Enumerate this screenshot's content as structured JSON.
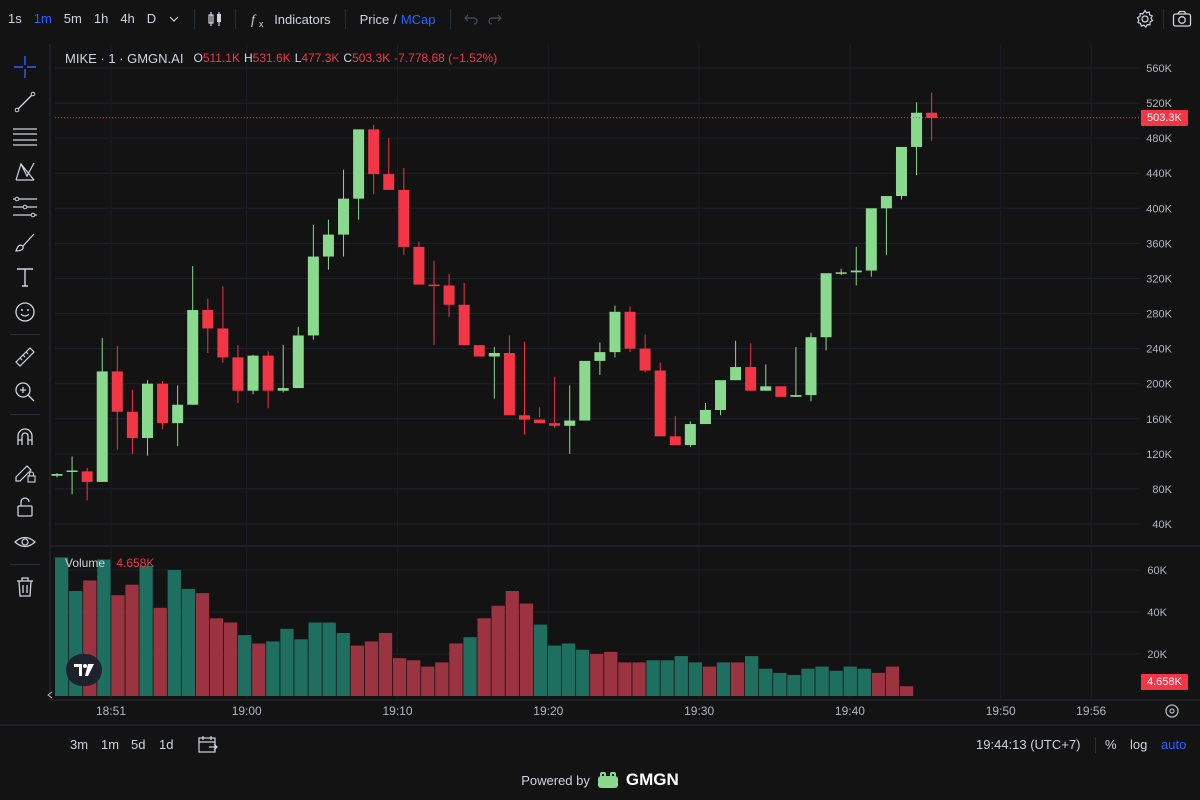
{
  "topbar": {
    "timeframes": [
      {
        "label": "1s",
        "active": false
      },
      {
        "label": "1m",
        "active": true
      },
      {
        "label": "5m",
        "active": false
      },
      {
        "label": "1h",
        "active": false
      },
      {
        "label": "4h",
        "active": false
      },
      {
        "label": "D",
        "active": false
      }
    ],
    "indicators_label": "Indicators",
    "price_label": "Price",
    "slash": "/",
    "mcap_label": "MCap"
  },
  "legend": {
    "symbol": "MIKE · 1 · GMGN.AI",
    "open_key": "O",
    "open": "511.1K",
    "high_key": "H",
    "high": "531.6K",
    "low_key": "L",
    "low": "477.3K",
    "close_key": "C",
    "close": "503.3K",
    "change": "-7.778,68 (−1.52%)"
  },
  "volume_legend": {
    "label": "Volume",
    "value": "4.658K"
  },
  "price_axis_labels": [
    "560K",
    "520K",
    "480K",
    "440K",
    "400K",
    "360K",
    "320K",
    "280K",
    "240K",
    "200K",
    "160K",
    "120K",
    "80K",
    "40K"
  ],
  "volume_axis_labels": [
    "60K",
    "40K",
    "20K"
  ],
  "last_price_tag": "503.3K",
  "last_volume_tag": "4.658K",
  "time_axis_labels": [
    "18:51",
    "19:00",
    "19:10",
    "19:20",
    "19:30",
    "19:40",
    "19:50",
    "19:56"
  ],
  "bottombar": {
    "ranges": [
      "3m",
      "1m",
      "5d",
      "1d"
    ],
    "clock": "19:44:13 (UTC+7)",
    "percent": "%",
    "log": "log",
    "auto": "auto"
  },
  "powered": {
    "text": "Powered by",
    "brand": "GMGN"
  },
  "colors": {
    "up": "#89d98f",
    "down": "#f23645",
    "vol_up": "#1f6f60",
    "vol_down": "#9b3440"
  },
  "chart_data": {
    "type": "candlestick",
    "symbol": "MIKE",
    "interval": "1m",
    "x": [
      "18:48",
      "18:49",
      "18:50",
      "18:51",
      "18:52",
      "18:53",
      "18:54",
      "18:55",
      "18:56",
      "18:57",
      "18:58",
      "18:59",
      "19:00",
      "19:01",
      "19:02",
      "19:03",
      "19:04",
      "19:05",
      "19:06",
      "19:07",
      "19:08",
      "19:09",
      "19:10",
      "19:11",
      "19:12",
      "19:13",
      "19:14",
      "19:15",
      "19:16",
      "19:17",
      "19:18",
      "19:19",
      "19:20",
      "19:21",
      "19:22",
      "19:23",
      "19:24",
      "19:25",
      "19:26",
      "19:27",
      "19:28",
      "19:29",
      "19:30",
      "19:31",
      "19:32",
      "19:33",
      "19:34",
      "19:35",
      "19:36",
      "19:37",
      "19:38",
      "19:39",
      "19:40",
      "19:41",
      "19:42",
      "19:43",
      "19:44"
    ],
    "ohlc": [
      [
        95,
        98,
        93,
        97
      ],
      [
        100,
        117,
        74,
        101
      ],
      [
        100,
        104,
        67,
        88
      ],
      [
        88,
        252,
        88,
        214
      ],
      [
        214,
        243,
        125,
        168
      ],
      [
        168,
        193,
        120,
        138
      ],
      [
        138,
        204,
        118,
        200
      ],
      [
        200,
        203,
        148,
        155
      ],
      [
        155,
        198,
        129,
        176
      ],
      [
        176,
        334,
        176,
        284
      ],
      [
        284,
        297,
        235,
        263
      ],
      [
        263,
        311,
        224,
        230
      ],
      [
        230,
        244,
        178,
        192
      ],
      [
        192,
        233,
        188,
        232
      ],
      [
        232,
        237,
        172,
        192
      ],
      [
        192,
        244,
        190,
        195
      ],
      [
        195,
        265,
        195,
        255
      ],
      [
        255,
        381,
        250,
        345
      ],
      [
        345,
        387,
        330,
        370
      ],
      [
        370,
        444,
        345,
        411
      ],
      [
        411,
        473,
        387,
        490
      ],
      [
        490,
        495,
        416,
        439
      ],
      [
        439,
        480,
        425,
        421
      ],
      [
        421,
        446,
        347,
        356
      ],
      [
        356,
        362,
        319,
        313
      ],
      [
        313,
        340,
        244,
        312
      ],
      [
        312,
        325,
        276,
        290
      ],
      [
        290,
        315,
        274,
        244
      ],
      [
        244,
        241,
        241,
        231
      ],
      [
        231,
        242,
        183,
        235
      ],
      [
        235,
        255,
        169,
        164
      ],
      [
        164,
        248,
        142,
        159
      ],
      [
        159,
        173,
        162,
        155
      ],
      [
        155,
        208,
        150,
        152
      ],
      [
        152,
        198,
        120,
        158
      ],
      [
        158,
        223,
        160,
        226
      ],
      [
        226,
        247,
        210,
        236
      ],
      [
        236,
        289,
        230,
        282
      ],
      [
        282,
        288,
        236,
        240
      ],
      [
        240,
        256,
        213,
        215
      ],
      [
        215,
        224,
        150,
        140
      ],
      [
        140,
        163,
        137,
        130
      ],
      [
        130,
        157,
        128,
        154
      ],
      [
        154,
        178,
        154,
        170
      ],
      [
        170,
        191,
        164,
        204
      ],
      [
        204,
        249,
        204,
        219
      ],
      [
        219,
        246,
        212,
        192
      ],
      [
        192,
        222,
        192,
        197
      ],
      [
        197,
        192,
        185,
        185
      ],
      [
        185,
        242,
        185,
        187
      ],
      [
        187,
        258,
        180,
        253
      ],
      [
        253,
        298,
        238,
        326
      ],
      [
        326,
        331,
        324,
        327
      ],
      [
        327,
        356,
        312,
        329
      ],
      [
        329,
        395,
        322,
        400
      ],
      [
        400,
        410,
        347,
        414
      ],
      [
        414,
        462,
        410,
        470
      ],
      [
        470,
        521,
        438,
        509
      ],
      [
        509,
        532,
        477,
        503
      ]
    ],
    "volume": [
      66,
      50,
      55,
      65,
      48,
      53,
      62,
      42,
      60,
      51,
      49,
      37,
      35,
      29,
      25,
      26,
      32,
      27,
      35,
      35,
      30,
      24,
      26,
      30,
      18,
      17,
      14,
      16,
      25,
      28,
      37,
      43,
      50,
      44,
      34,
      24,
      25,
      22,
      20,
      21,
      16,
      16,
      17,
      17,
      19,
      16,
      14,
      16,
      16,
      19,
      13,
      11,
      10,
      13,
      14,
      12,
      14,
      13,
      11,
      14,
      4.658
    ],
    "y_range": [
      0,
      580000
    ],
    "volume_range": [
      0,
      70000
    ],
    "last_price": 503300,
    "last_volume": 4658
  }
}
